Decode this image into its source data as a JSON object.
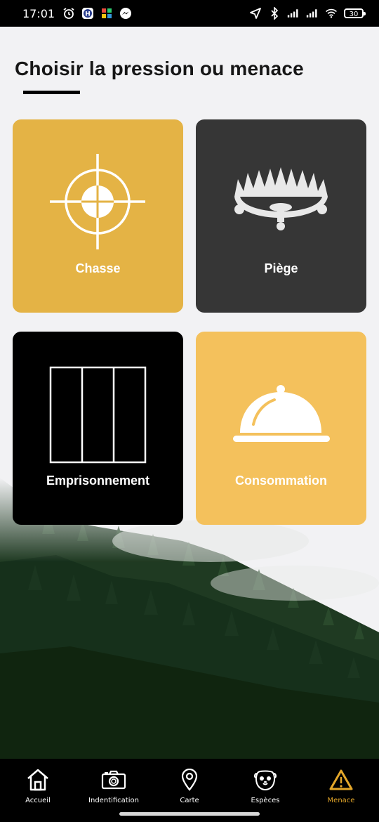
{
  "status_bar": {
    "time": "17:01",
    "battery": "30",
    "icons": [
      "alarm-icon",
      "app-h-icon",
      "app-grid-icon",
      "messenger-icon",
      "location-arrow-icon",
      "bluetooth-icon",
      "signal-icon",
      "signal-icon",
      "wifi-icon",
      "battery-icon"
    ]
  },
  "page": {
    "title": "Choisir la pression ou menace"
  },
  "cards": [
    {
      "label": "Chasse",
      "icon": "crosshair-icon",
      "color": "#e4b345"
    },
    {
      "label": "Piège",
      "icon": "bear-trap-icon",
      "color": "#363636"
    },
    {
      "label": "Emprisonnement",
      "icon": "prison-bars-icon",
      "color": "#000000"
    },
    {
      "label": "Consommation",
      "icon": "food-cloche-icon",
      "color": "#f4c15c"
    }
  ],
  "nav": {
    "items": [
      {
        "label": "Accueil",
        "icon": "home-icon"
      },
      {
        "label": "Indentification",
        "icon": "camera-icon"
      },
      {
        "label": "Carte",
        "icon": "map-pin-icon"
      },
      {
        "label": "Espèces",
        "icon": "animal-face-icon"
      },
      {
        "label": "Menace",
        "icon": "warning-icon"
      }
    ],
    "active": "Menace",
    "active_color": "#e4a72a"
  }
}
